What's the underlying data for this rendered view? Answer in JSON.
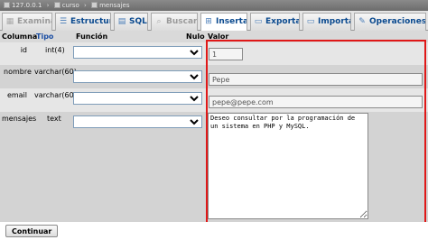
{
  "breadcrumb": {
    "server": "127.0.0.1",
    "database": "curso",
    "table": "mensajes"
  },
  "tabs": [
    {
      "label": "Examinar",
      "icon": "table-icon",
      "state": "disabled"
    },
    {
      "label": "Estructura",
      "icon": "structure-icon",
      "state": "normal"
    },
    {
      "label": "SQL",
      "icon": "sql-icon",
      "state": "normal"
    },
    {
      "label": "Buscar",
      "icon": "search-icon",
      "state": "disabled"
    },
    {
      "label": "Insertar",
      "icon": "insert-icon",
      "state": "active"
    },
    {
      "label": "Exportar",
      "icon": "export-icon",
      "state": "normal"
    },
    {
      "label": "Importar",
      "icon": "import-icon",
      "state": "normal"
    },
    {
      "label": "Operaciones",
      "icon": "wrench-icon",
      "state": "normal"
    }
  ],
  "header": {
    "columna": "Columna",
    "tipo": "Tipo",
    "funcion": "Función",
    "nulo": "Nulo",
    "valor": "Valor"
  },
  "rows": [
    {
      "column": "id",
      "type": "int(4)",
      "value": "1"
    },
    {
      "column": "nombre",
      "type": "varchar(60)",
      "value": "Pepe"
    },
    {
      "column": "email",
      "type": "varchar(60)",
      "value": "pepe@pepe.com"
    },
    {
      "column": "mensajes",
      "type": "text",
      "value": "Deseo consultar por la programación de un sistema en PHP y MySQL."
    }
  ],
  "footer": {
    "submit_label": "Continuar"
  },
  "colors": {
    "highlight_border": "#e01818",
    "link": "#1b4ea3",
    "row_odd": "#e6e6e6",
    "row_even": "#d3d3d3"
  }
}
